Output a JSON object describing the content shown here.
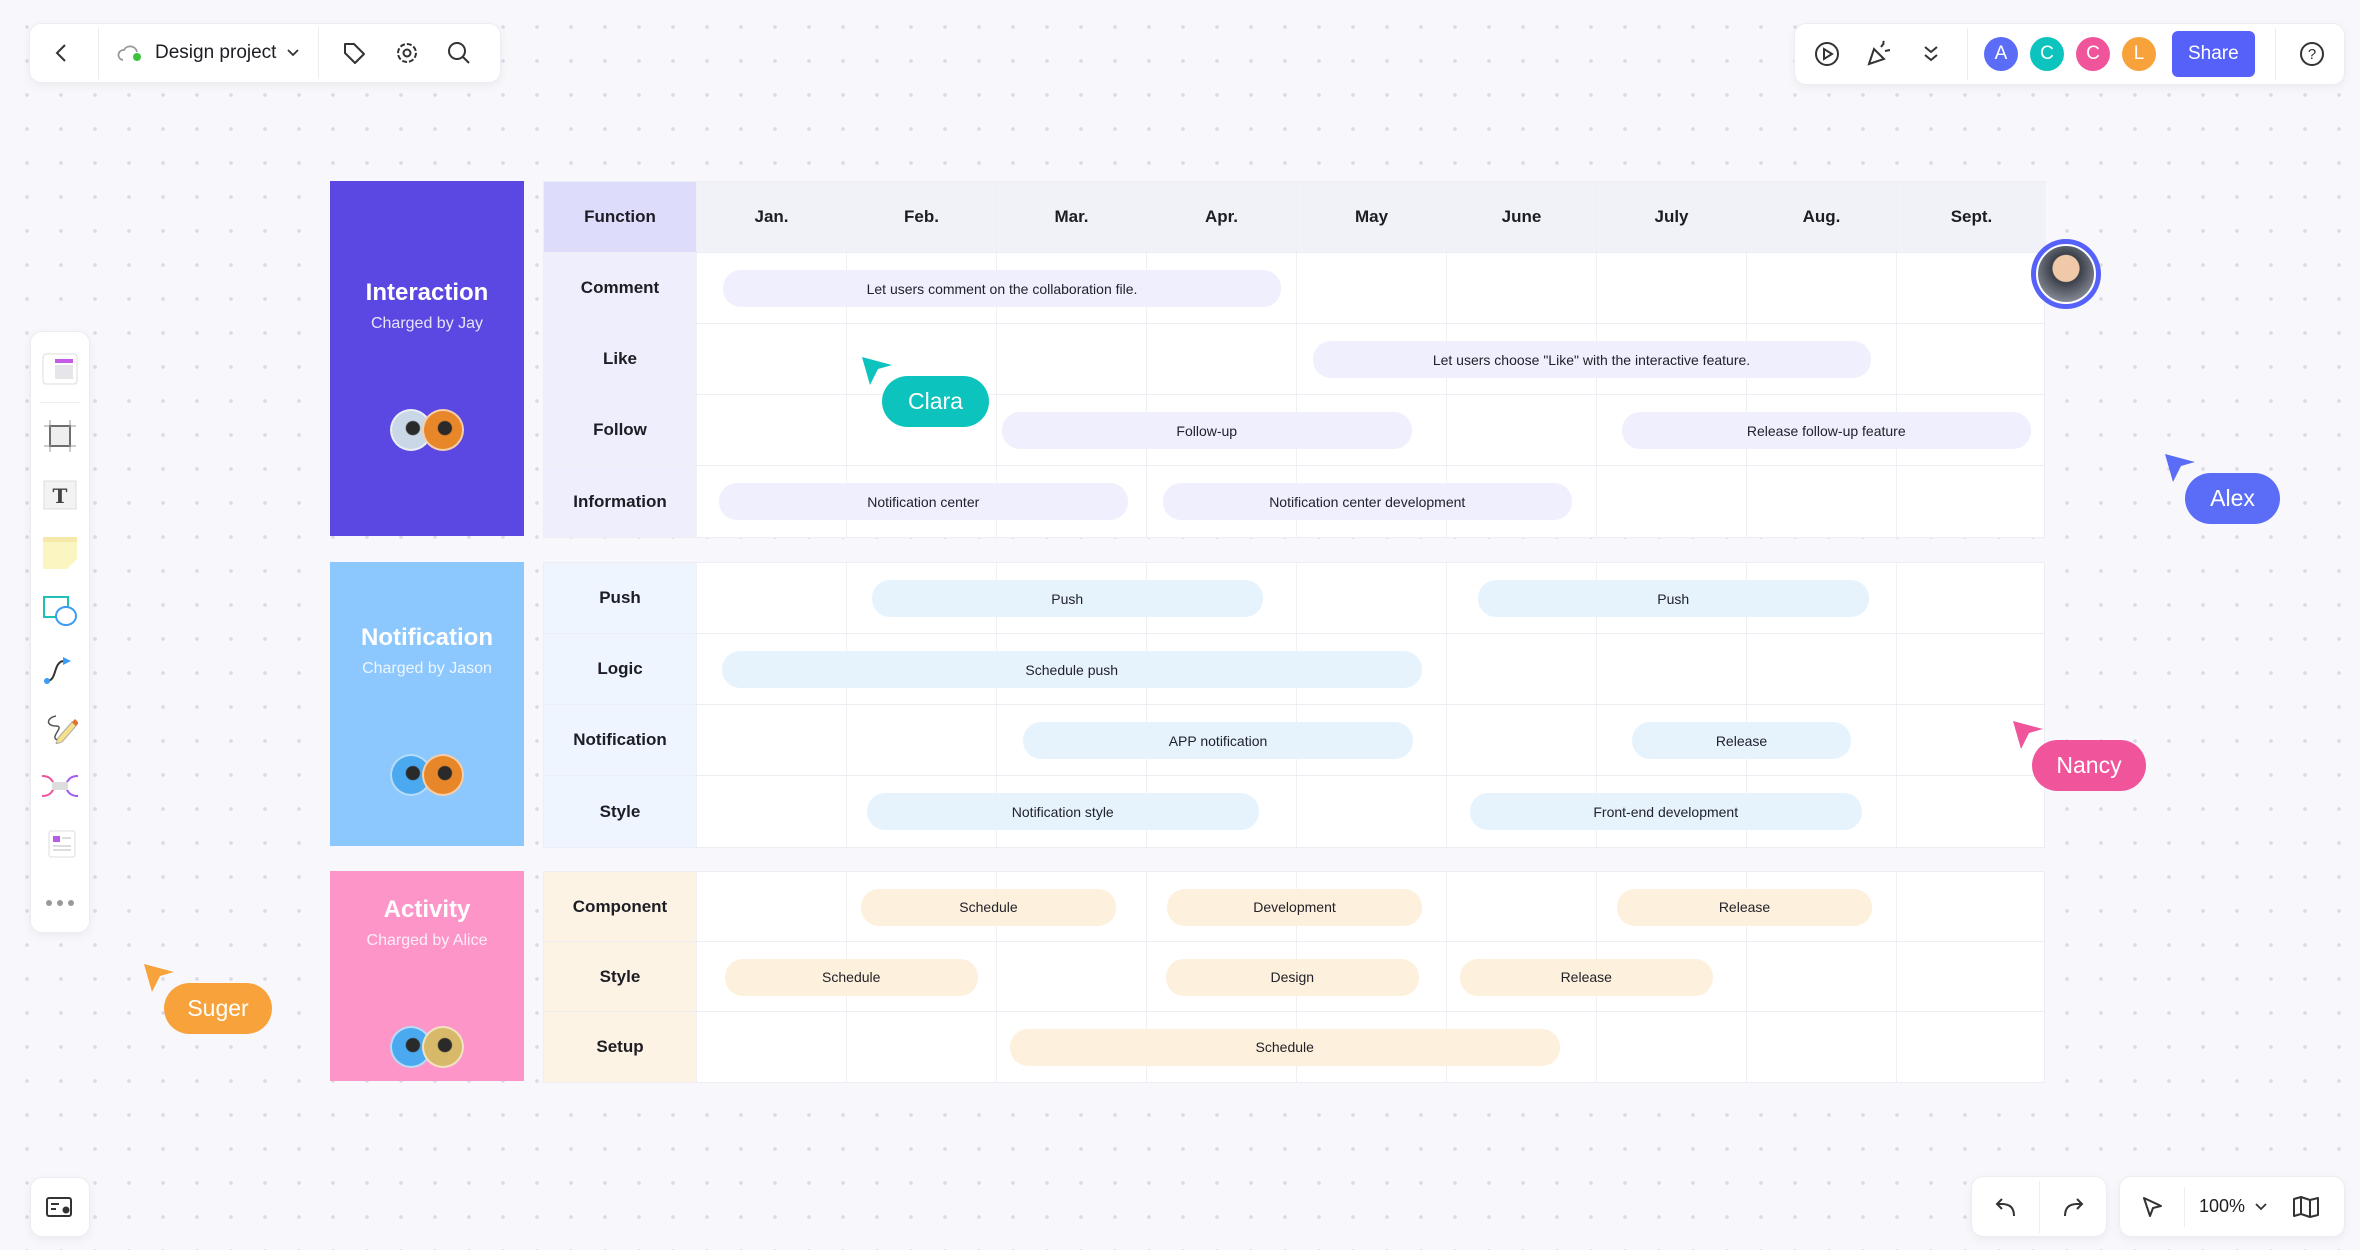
{
  "topbar": {
    "project_name": "Design project",
    "collaborators": [
      {
        "initial": "A",
        "color": "#5b6cf7"
      },
      {
        "initial": "C",
        "color": "#0cc3bd"
      },
      {
        "initial": "C",
        "color": "#f0559c"
      },
      {
        "initial": "L",
        "color": "#f7a23a"
      }
    ],
    "share_label": "Share"
  },
  "zoom": {
    "level": "100%"
  },
  "table": {
    "header": {
      "function_label": "Function",
      "months": [
        "Jan.",
        "Feb.",
        "Mar.",
        "Apr.",
        "May",
        "June",
        "July",
        "Aug.",
        "Sept."
      ]
    },
    "sections": [
      {
        "title": "Interaction",
        "owner": "Charged by Jay",
        "color": "#5b48e2",
        "fn_bg": "#efeefd",
        "bar_bg": "#efeffd",
        "avatars": [
          "#c9d7e6",
          "#e8862a"
        ],
        "rows": [
          {
            "function": "Comment",
            "bars": [
              {
                "label": "Let users comment on the collaboration file.",
                "start": 0.18,
                "end": 3.9
              }
            ]
          },
          {
            "function": "Like",
            "bars": [
              {
                "label": "Let users choose \"Like\" with the interactive feature.",
                "start": 4.11,
                "end": 7.83
              }
            ]
          },
          {
            "function": "Follow",
            "bars": [
              {
                "label": "Follow-up",
                "start": 2.04,
                "end": 4.77
              },
              {
                "label": "Release follow-up feature",
                "start": 6.17,
                "end": 8.9
              }
            ]
          },
          {
            "function": "Information",
            "bars": [
              {
                "label": "Notification center",
                "start": 0.15,
                "end": 2.88
              },
              {
                "label": "Notification center development",
                "start": 3.11,
                "end": 5.84
              }
            ]
          }
        ]
      },
      {
        "title": "Notification",
        "owner": "Charged by Jason",
        "color": "#8cc7fd",
        "fn_bg": "#eef5fe",
        "bar_bg": "#e6f3fd",
        "avatars": [
          "#4aa9ef",
          "#e8862a"
        ],
        "rows": [
          {
            "function": "Push",
            "bars": [
              {
                "label": "Push",
                "start": 1.17,
                "end": 3.78
              },
              {
                "label": "Push",
                "start": 5.21,
                "end": 7.82
              }
            ]
          },
          {
            "function": "Logic",
            "bars": [
              {
                "label": "Schedule push",
                "start": 0.17,
                "end": 4.84
              }
            ]
          },
          {
            "function": "Notification",
            "bars": [
              {
                "label": "APP notification",
                "start": 2.18,
                "end": 4.78
              },
              {
                "label": "Release",
                "start": 6.24,
                "end": 7.7
              }
            ]
          },
          {
            "function": "Style",
            "bars": [
              {
                "label": "Notification style",
                "start": 1.14,
                "end": 3.75
              },
              {
                "label": "Front-end development",
                "start": 5.16,
                "end": 7.77
              }
            ]
          }
        ]
      },
      {
        "title": "Activity",
        "owner": "Charged by Alice",
        "color": "#fe95c9",
        "fn_bg": "#fdf3e4",
        "bar_bg": "#fdf0dc",
        "avatars": [
          "#4aa9ef",
          "#d8b96a"
        ],
        "rows": [
          {
            "function": "Component",
            "bars": [
              {
                "label": "Schedule",
                "start": 1.1,
                "end": 2.8
              },
              {
                "label": "Development",
                "start": 3.14,
                "end": 4.84
              },
              {
                "label": "Release",
                "start": 6.14,
                "end": 7.84
              }
            ]
          },
          {
            "function": "Style",
            "bars": [
              {
                "label": "Schedule",
                "start": 0.19,
                "end": 1.88
              },
              {
                "label": "Design",
                "start": 3.13,
                "end": 4.82
              },
              {
                "label": "Release",
                "start": 5.09,
                "end": 6.78
              }
            ]
          },
          {
            "function": "Setup",
            "bars": [
              {
                "label": "Schedule",
                "start": 2.09,
                "end": 5.76
              }
            ]
          }
        ]
      }
    ]
  },
  "cursors": [
    {
      "name": "Clara",
      "color": "#0cc3bd"
    },
    {
      "name": "Alex",
      "color": "#5b6cf7"
    },
    {
      "name": "Nancy",
      "color": "#f0559c"
    },
    {
      "name": "Suger",
      "color": "#f7a23a"
    }
  ]
}
